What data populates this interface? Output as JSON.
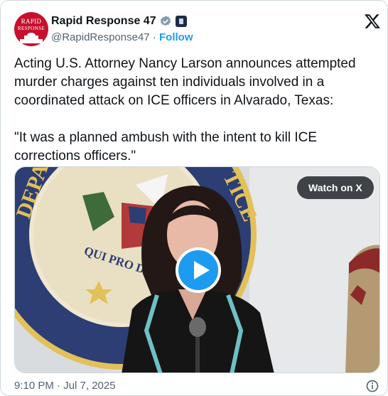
{
  "account": {
    "avatar_line1": "RAPID",
    "avatar_line2": "RESPONSE",
    "display_name": "Rapid Response 47",
    "handle": "@RapidResponse47",
    "separator": " · ",
    "follow_label": "Follow"
  },
  "tweet": {
    "paragraph1": "Acting U.S. Attorney Nancy Larson announces attempted murder charges against ten individuals involved in a coordinated attack on ICE officers in Alvarado, Texas:",
    "paragraph2": "\"It was a planned ambush with the intent to kill ICE corrections officers.\"",
    "timestamp": "9:10 PM · Jul 7, 2025"
  },
  "media": {
    "watch_label": "Watch on X",
    "seal_text_top": "DEPA",
    "seal_text_right": "TICE",
    "seal_motto": "QUI PRO DOMINA",
    "play_icon": "play-icon"
  },
  "colors": {
    "accent": "#1d9bf0",
    "text": "#0f1419",
    "muted": "#536471",
    "avatar_bg": "#c8102e"
  }
}
